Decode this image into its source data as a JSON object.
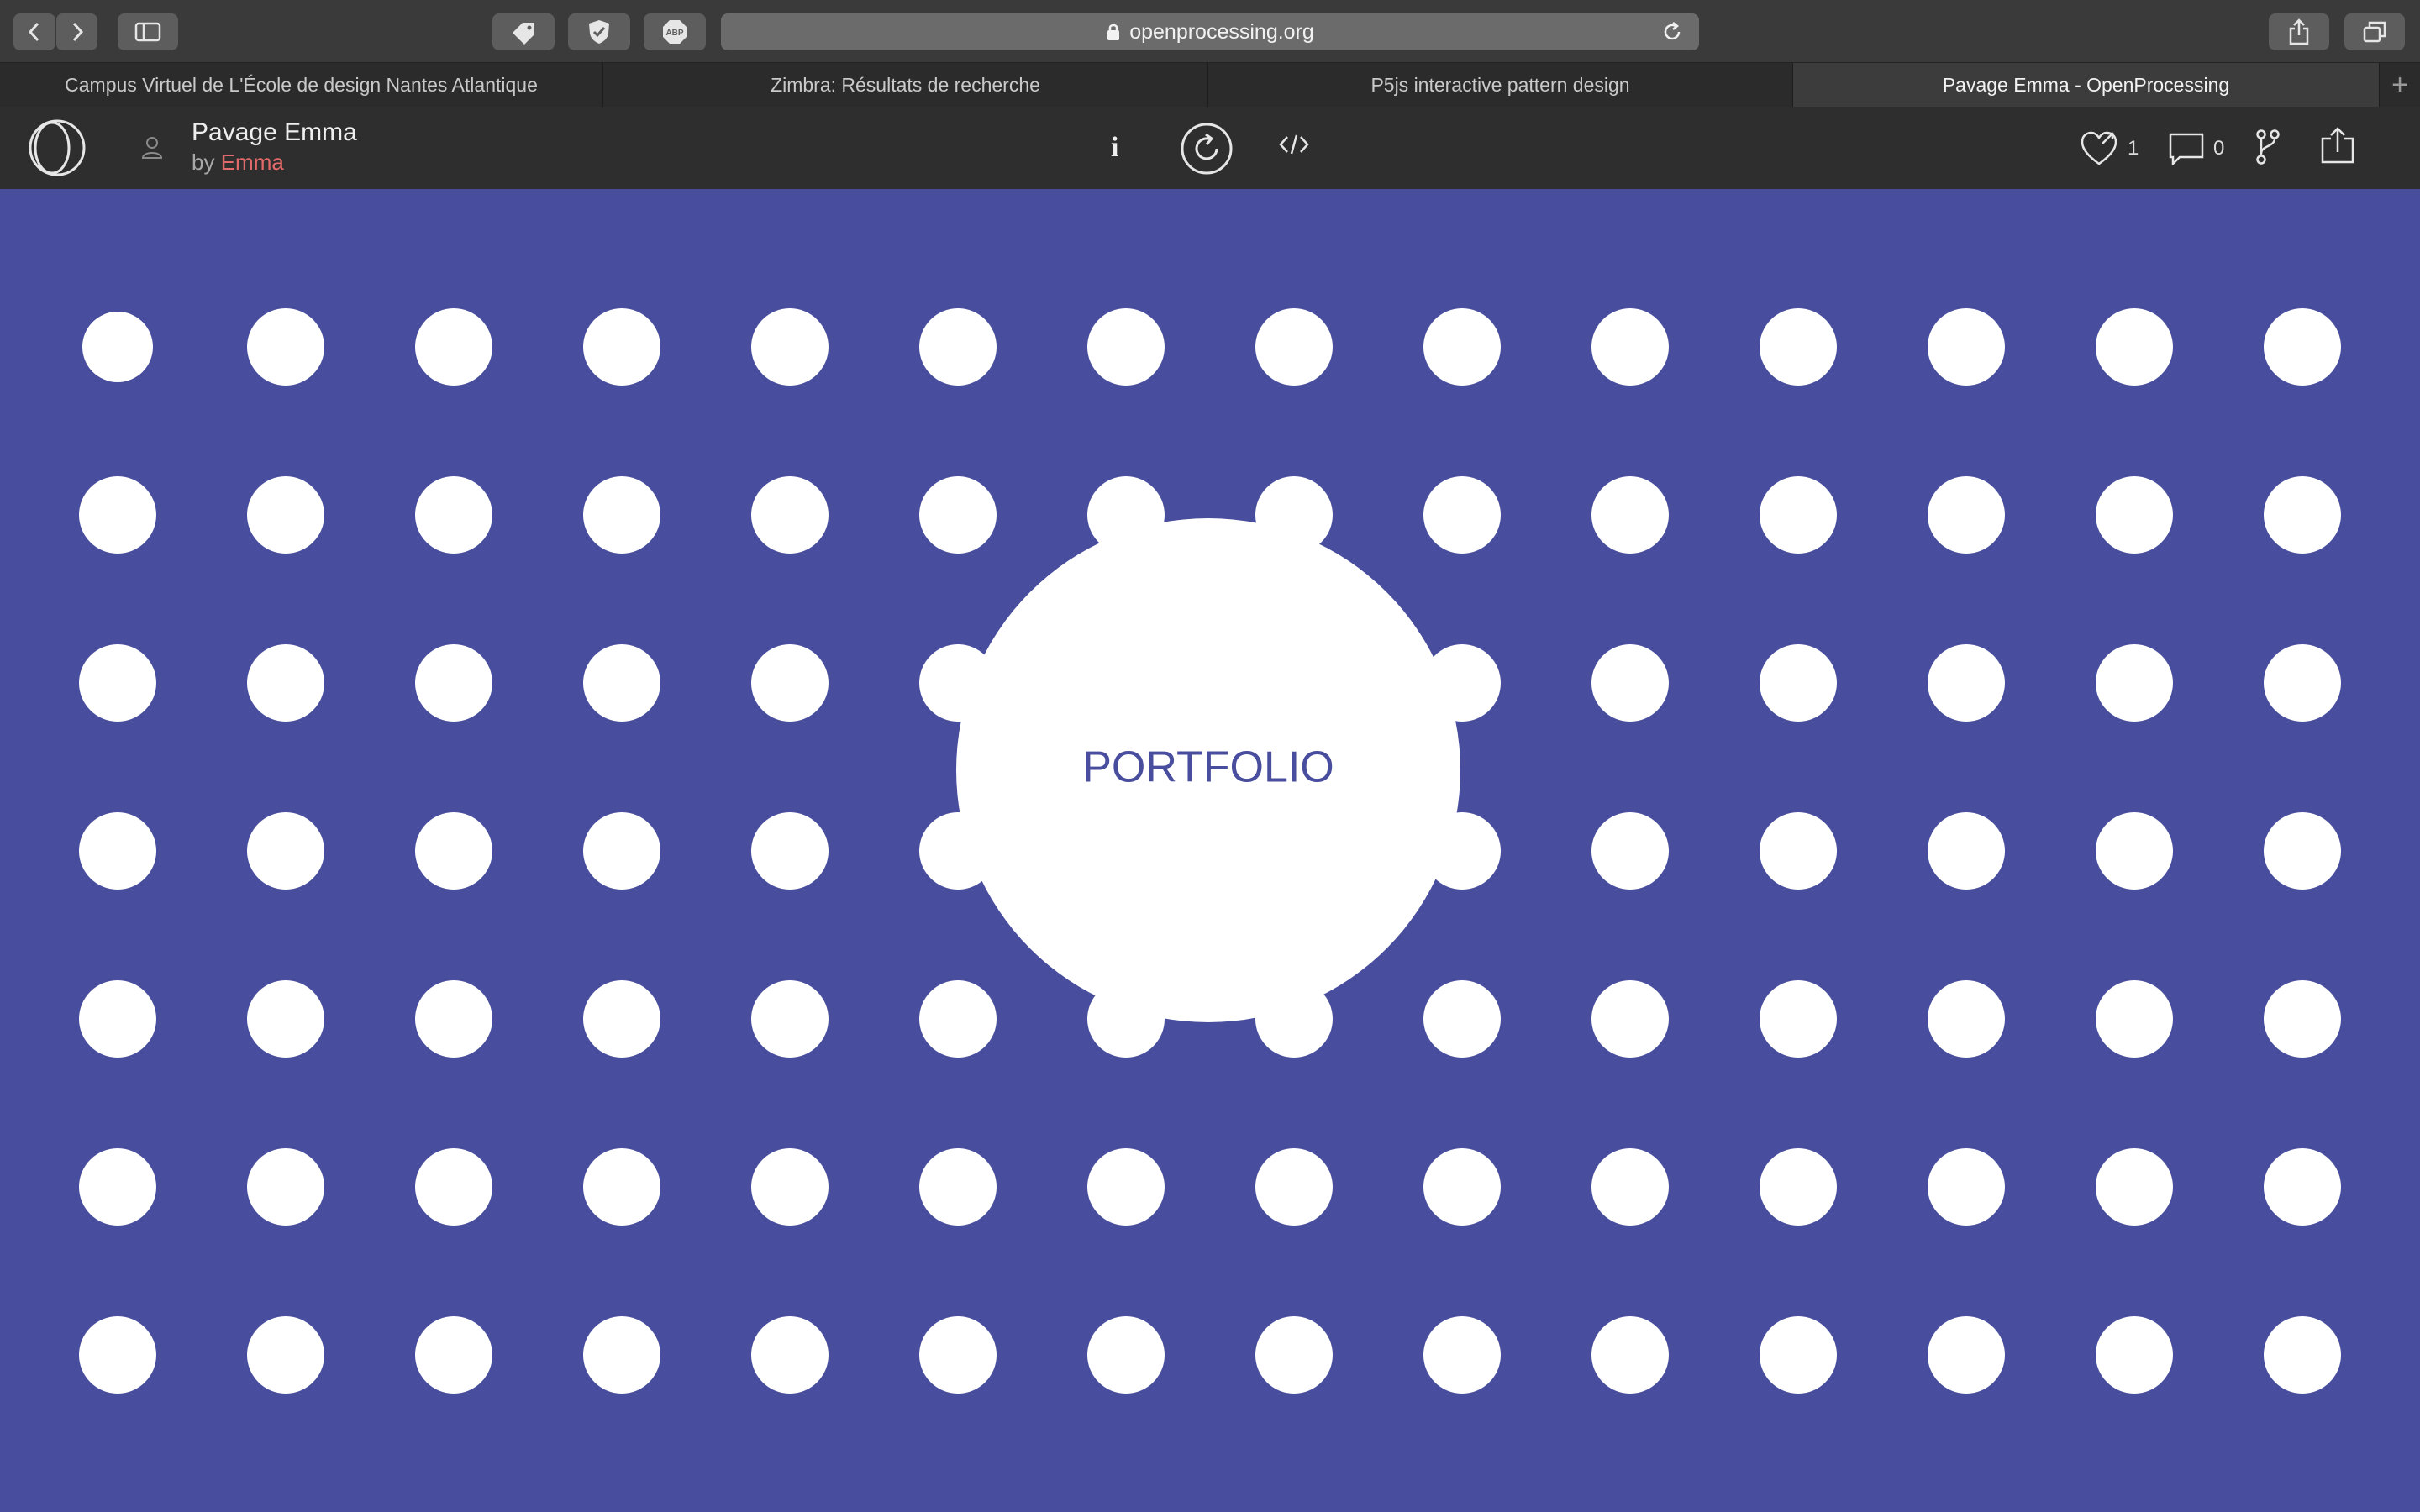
{
  "browser": {
    "url": "openprocessing.org",
    "tabs": [
      {
        "label": "Campus Virtuel de L'École de design Nantes Atlantique",
        "active": false
      },
      {
        "label": "Zimbra: Résultats de recherche",
        "active": false
      },
      {
        "label": "P5js interactive pattern design",
        "active": false
      },
      {
        "label": "Pavage Emma - OpenProcessing",
        "active": true
      }
    ],
    "new_tab_label": "+"
  },
  "header": {
    "title": "Pavage Emma",
    "by_label": "by",
    "author": "Emma",
    "info_label": "i",
    "likes": "1",
    "comments": "0"
  },
  "sketch": {
    "center_label": "PORTFOLIO",
    "background_color": "#484d9d",
    "dot_color": "#ffffff",
    "grid_columns": 14,
    "grid_rows": 7
  },
  "colors": {
    "toolbar": "#3a3a3a",
    "header": "#2e2e2e",
    "author": "#e26a6a",
    "accent": "#484d9d"
  }
}
